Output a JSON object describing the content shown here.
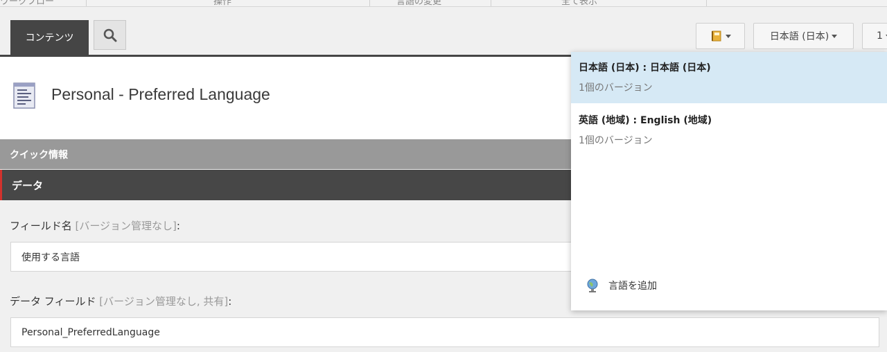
{
  "ribbon": {
    "items": [
      "ワークフロー",
      "操作",
      "言語の変更",
      "全て表示"
    ]
  },
  "tabs": {
    "content_label": "コンテンツ"
  },
  "toolbar": {
    "language_label": "日本語 (日本)",
    "version_label": "1"
  },
  "item": {
    "title": "Personal - Preferred Language"
  },
  "sections": {
    "quick_info": "クイック情報",
    "data": "データ"
  },
  "fields": [
    {
      "label": "フィールド名",
      "hint": "[バージョン管理なし]",
      "suffix": ":",
      "value": "使用する言語"
    },
    {
      "label": "データ フィールド",
      "hint": "[バージョン管理なし, 共有]",
      "suffix": ":",
      "value": "Personal_PreferredLanguage"
    }
  ],
  "language_dropdown": {
    "items": [
      {
        "name": "日本語 (日本) : 日本語 (日本)",
        "versions": "1個のバージョン"
      },
      {
        "name": "英語 (地域) : English (地域)",
        "versions": "1個のバージョン"
      }
    ],
    "add_label": "言語を追加"
  }
}
